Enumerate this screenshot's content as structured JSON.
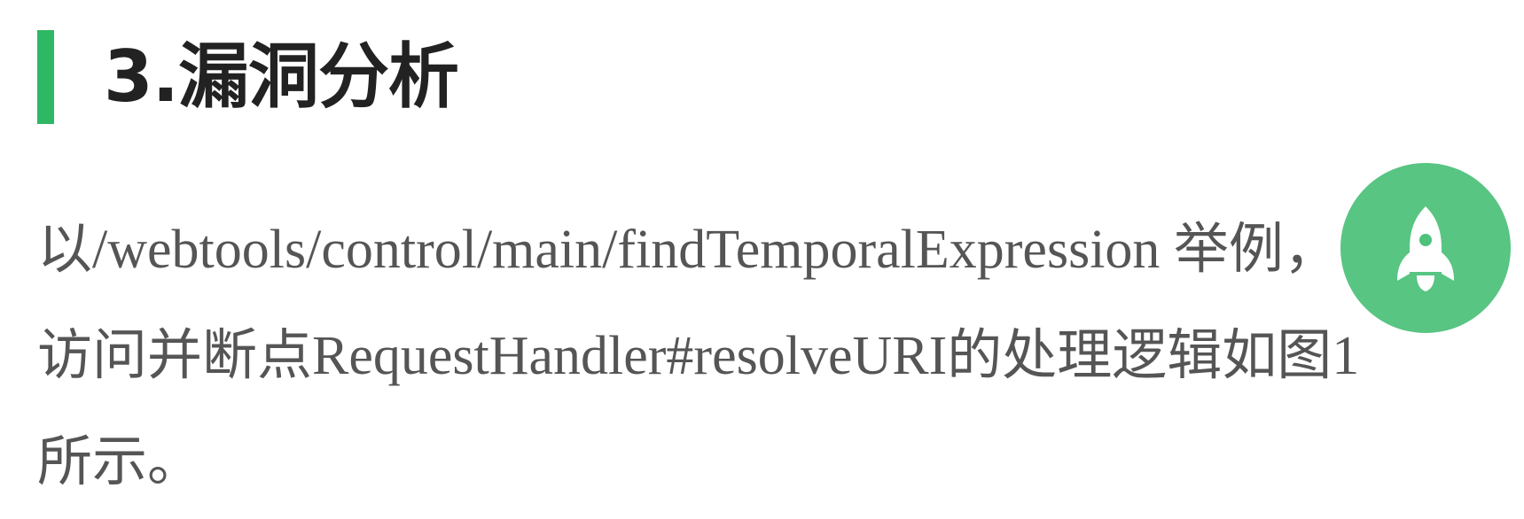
{
  "section": {
    "heading": "3.漏洞分析"
  },
  "paragraph": {
    "lines": [
      "以/webtools/control/main/findTemporalExpression 举例，",
      "访问并断点RequestHandler#resolveURI的处理逻辑如图1",
      "所示。"
    ]
  },
  "colors": {
    "accent": "#2eb764",
    "heading_text": "#222222",
    "body_text": "#555555",
    "float_button": "#2eb764"
  },
  "icons": {
    "float_button": "rocket-icon"
  }
}
